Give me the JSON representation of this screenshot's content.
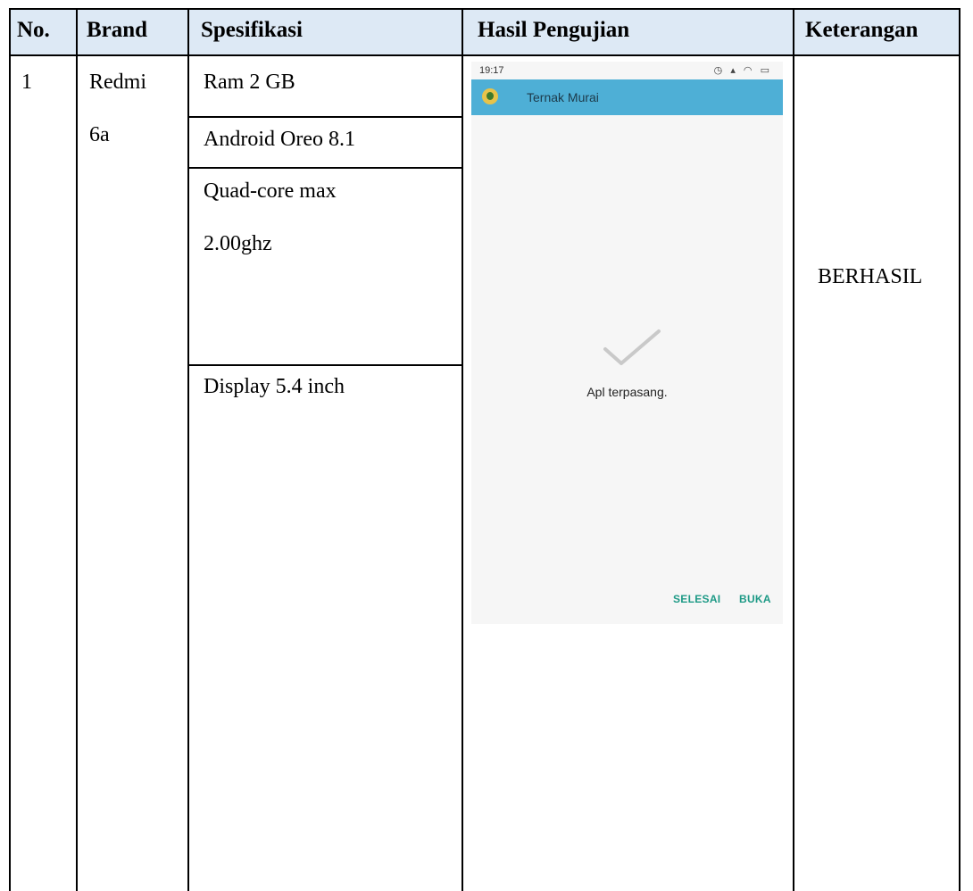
{
  "table": {
    "headers": {
      "no": "No.",
      "brand": "Brand",
      "spec": "Spesifikasi",
      "result": "Hasil Pengujian",
      "note": "Keterangan"
    },
    "row": {
      "no": "1",
      "brand_line1": "Redmi",
      "brand_line2": "6a",
      "specs": {
        "ram": "Ram 2 GB",
        "os": "Android Oreo 8.1",
        "cpu_line1": "Quad-core max",
        "cpu_line2": "2.00ghz",
        "display": "Display 5.4 inch"
      },
      "note": "BERHASIL"
    }
  },
  "phone": {
    "status_time": "19:17",
    "app_title": "Ternak Murai",
    "icon": "checkmark-icon",
    "message": "Apl terpasang.",
    "done_label": "SELESAI",
    "open_label": "BUKA"
  },
  "colors": {
    "header_bg": "#dde9f5",
    "app_bar": "#4eafd6",
    "button_text": "#1e9a86"
  }
}
